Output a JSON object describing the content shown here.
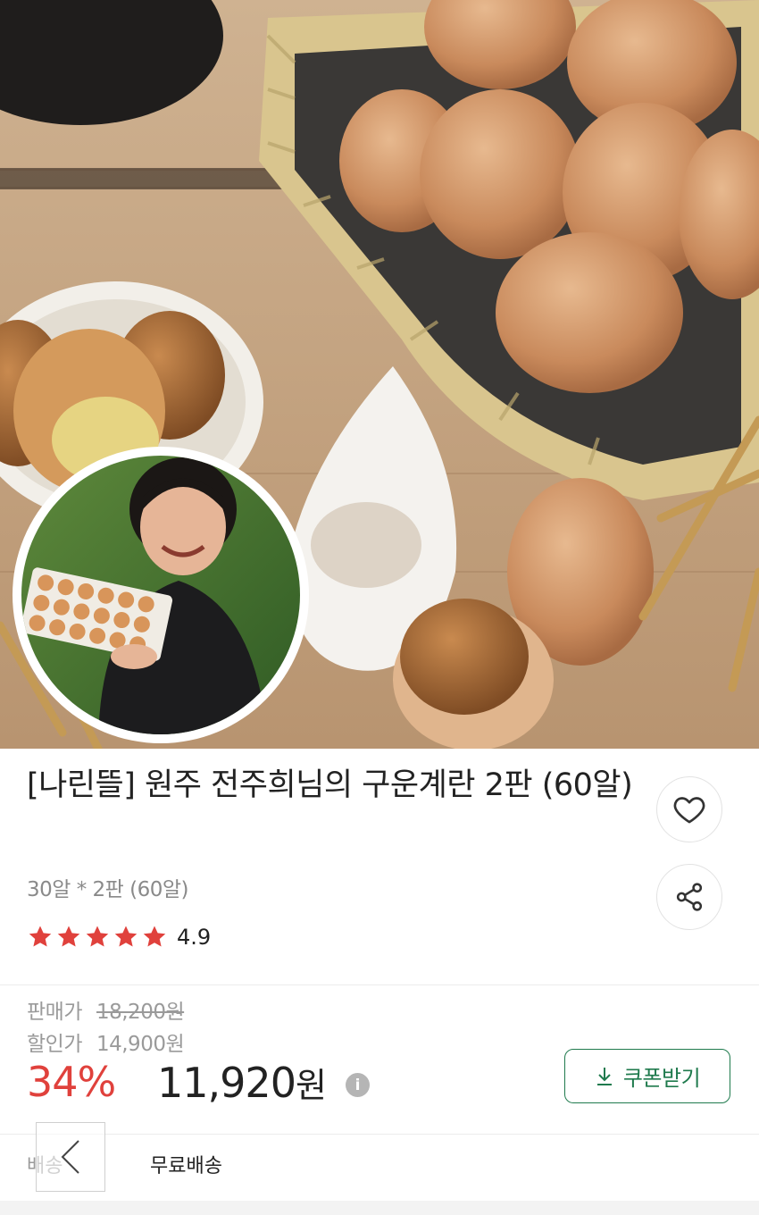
{
  "product": {
    "title": "[나린뜰] 원주 전주희님의 구운계란 2판 (60알)",
    "option": "30알 * 2판 (60알)",
    "rating": {
      "value": "4.9",
      "stars": 5
    }
  },
  "price": {
    "sale_label": "판매가",
    "sale_value": "18,200원",
    "discount_label": "할인가",
    "discount_value": "14,900원",
    "discount_rate": "34%",
    "final_amount": "11,920",
    "final_unit": "원",
    "info_glyph": "i"
  },
  "coupon": {
    "label": "쿠폰받기"
  },
  "shipping": {
    "label": "배송",
    "value": "무료배송"
  },
  "icons": {
    "wishlist": "heart-icon",
    "share": "share-icon",
    "download": "download-icon",
    "back": "chevron-left-icon",
    "star": "star-icon",
    "info": "info-icon"
  },
  "colors": {
    "discount": "#e0413c",
    "star": "#e0413c",
    "coupon": "#1f7a4d"
  }
}
